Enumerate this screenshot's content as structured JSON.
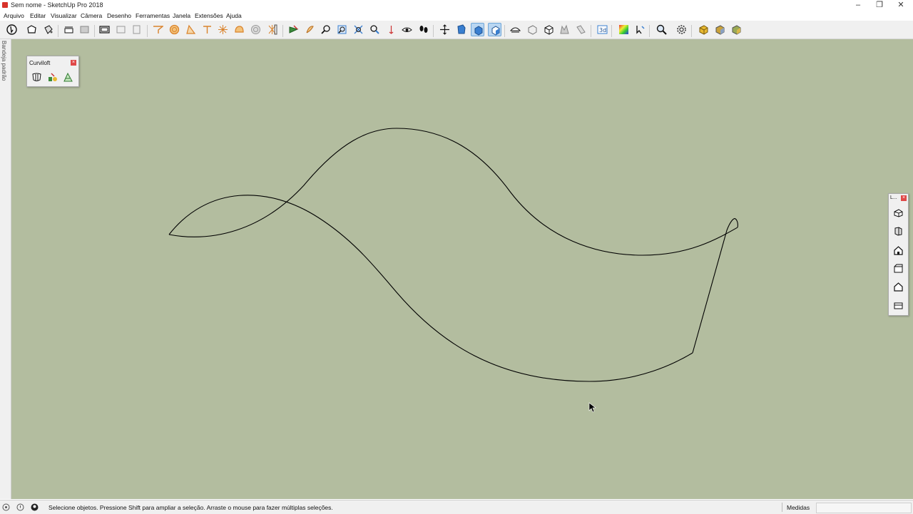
{
  "window": {
    "title": "Sem nome - SketchUp Pro 2018"
  },
  "menu": [
    "Arquivo",
    "Editar",
    "Visualizar",
    "Câmera",
    "Desenho",
    "Ferramentas",
    "Janela",
    "Extensões",
    "Ajuda"
  ],
  "tray": {
    "label": "Bandeja padrão"
  },
  "curviloft": {
    "title": "Curviloft",
    "close": "×"
  },
  "views_panel": {
    "title": "L...",
    "close": "×"
  },
  "status": {
    "message": "Selecione objetos. Pressione Shift para ampliar a seleção. Arraste o mouse para fazer múltiplas seleções.",
    "measure_label": "Medidas",
    "measure_value": ""
  },
  "toolbar_icons": [
    "select-arrow-icon",
    "make-component-icon",
    "paint-bucket-icon",
    "eraser-icon",
    "line-icon",
    "rectangle-icon",
    "circle-icon",
    "arc-icon",
    "polygon-icon",
    "push-pull-icon",
    "follow-me-icon",
    "offset-icon",
    "move-icon",
    "rotate-icon",
    "scale-icon",
    "tape-measure-icon",
    "protractor-icon",
    "dimension-icon",
    "text-icon",
    "axes-icon",
    "3d-text-icon",
    "orbit-icon",
    "pan-icon",
    "zoom-icon",
    "zoom-window-icon",
    "zoom-extents-icon",
    "walk-icon",
    "look-around-icon",
    "position-camera-icon",
    "section-plane-icon",
    "xray-icon",
    "wireframe-icon",
    "shaded-icon",
    "shaded-textures-icon",
    "monochrome-icon",
    "styles-icon",
    "sandbox-icon",
    "color-by-layer-icon",
    "search-icon",
    "settings-icon",
    "warehouse-icon",
    "extension-warehouse-icon",
    "layout-icon"
  ],
  "colors": {
    "canvas": "#b3bd9f",
    "accent": "#3a7fd0",
    "tool_orange": "#d9822b"
  }
}
